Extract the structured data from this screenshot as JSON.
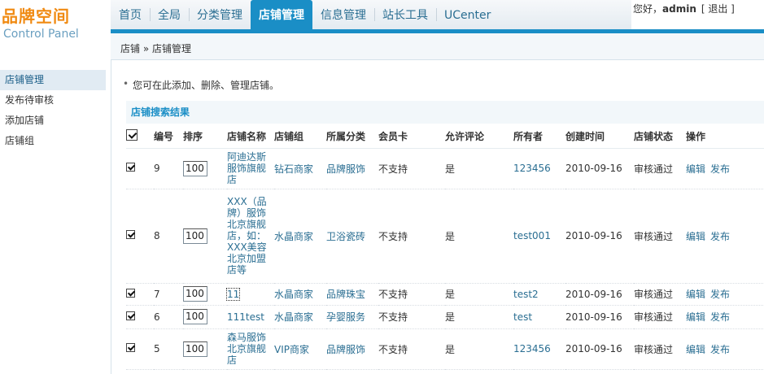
{
  "logo": {
    "title": "品牌空间",
    "subtitle": "Control Panel"
  },
  "nav": [
    {
      "label": "首页",
      "active": false
    },
    {
      "label": "全局",
      "active": false
    },
    {
      "label": "分类管理",
      "active": false
    },
    {
      "label": "店铺管理",
      "active": true
    },
    {
      "label": "信息管理",
      "active": false
    },
    {
      "label": "站长工具",
      "active": false
    },
    {
      "label": "UCenter",
      "active": false
    }
  ],
  "userbar": {
    "greeting": "您好，",
    "username": "admin",
    "logout": "[ 退出 ]"
  },
  "breadcrumb": "店铺 » 店铺管理",
  "sidebar": {
    "items": [
      {
        "label": "店铺管理",
        "active": true
      },
      {
        "label": "发布待审核",
        "active": false
      },
      {
        "label": "添加店铺",
        "active": false
      },
      {
        "label": "店铺组",
        "active": false
      }
    ]
  },
  "tip": "您可在此添加、删除、管理店铺。",
  "section_title": "店铺搜索结果",
  "table": {
    "headers": [
      "编号",
      "排序",
      "店铺名称",
      "店铺组",
      "所属分类",
      "会员卡",
      "允许评论",
      "所有者",
      "创建时间",
      "店铺状态",
      "操作"
    ],
    "rows": [
      {
        "id": "9",
        "order": "100",
        "name": "阿迪达斯服饰旗舰店",
        "group": "钻石商家",
        "category": "品牌服饰",
        "card": "不支持",
        "comment": "是",
        "owner": "123456",
        "created": "2010-09-16",
        "status": "审核通过",
        "op_edit": "编辑",
        "op_publish": "发布"
      },
      {
        "id": "8",
        "order": "100",
        "name": "XXX（品牌）服饰北京旗舰店，如：XXX美容北京加盟店等",
        "group": "水晶商家",
        "category": "卫浴瓷砖",
        "card": "不支持",
        "comment": "是",
        "owner": "test001",
        "created": "2010-09-16",
        "status": "审核通过",
        "op_edit": "编辑",
        "op_publish": "发布"
      },
      {
        "id": "7",
        "order": "100",
        "name": "11",
        "group": "水晶商家",
        "category": "品牌珠宝",
        "card": "不支持",
        "comment": "是",
        "owner": "test2",
        "created": "2010-09-16",
        "status": "审核通过",
        "op_edit": "编辑",
        "op_publish": "发布"
      },
      {
        "id": "6",
        "order": "100",
        "name": "111test",
        "group": "水晶商家",
        "category": "孕婴服务",
        "card": "不支持",
        "comment": "是",
        "owner": "test",
        "created": "2010-09-16",
        "status": "审核通过",
        "op_edit": "编辑",
        "op_publish": "发布"
      },
      {
        "id": "5",
        "order": "100",
        "name": "森马服饰北京旗舰店",
        "group": "VIP商家",
        "category": "品牌服饰",
        "card": "不支持",
        "comment": "是",
        "owner": "123456",
        "created": "2010-09-16",
        "status": "审核通过",
        "op_edit": "编辑",
        "op_publish": "发布"
      }
    ]
  }
}
